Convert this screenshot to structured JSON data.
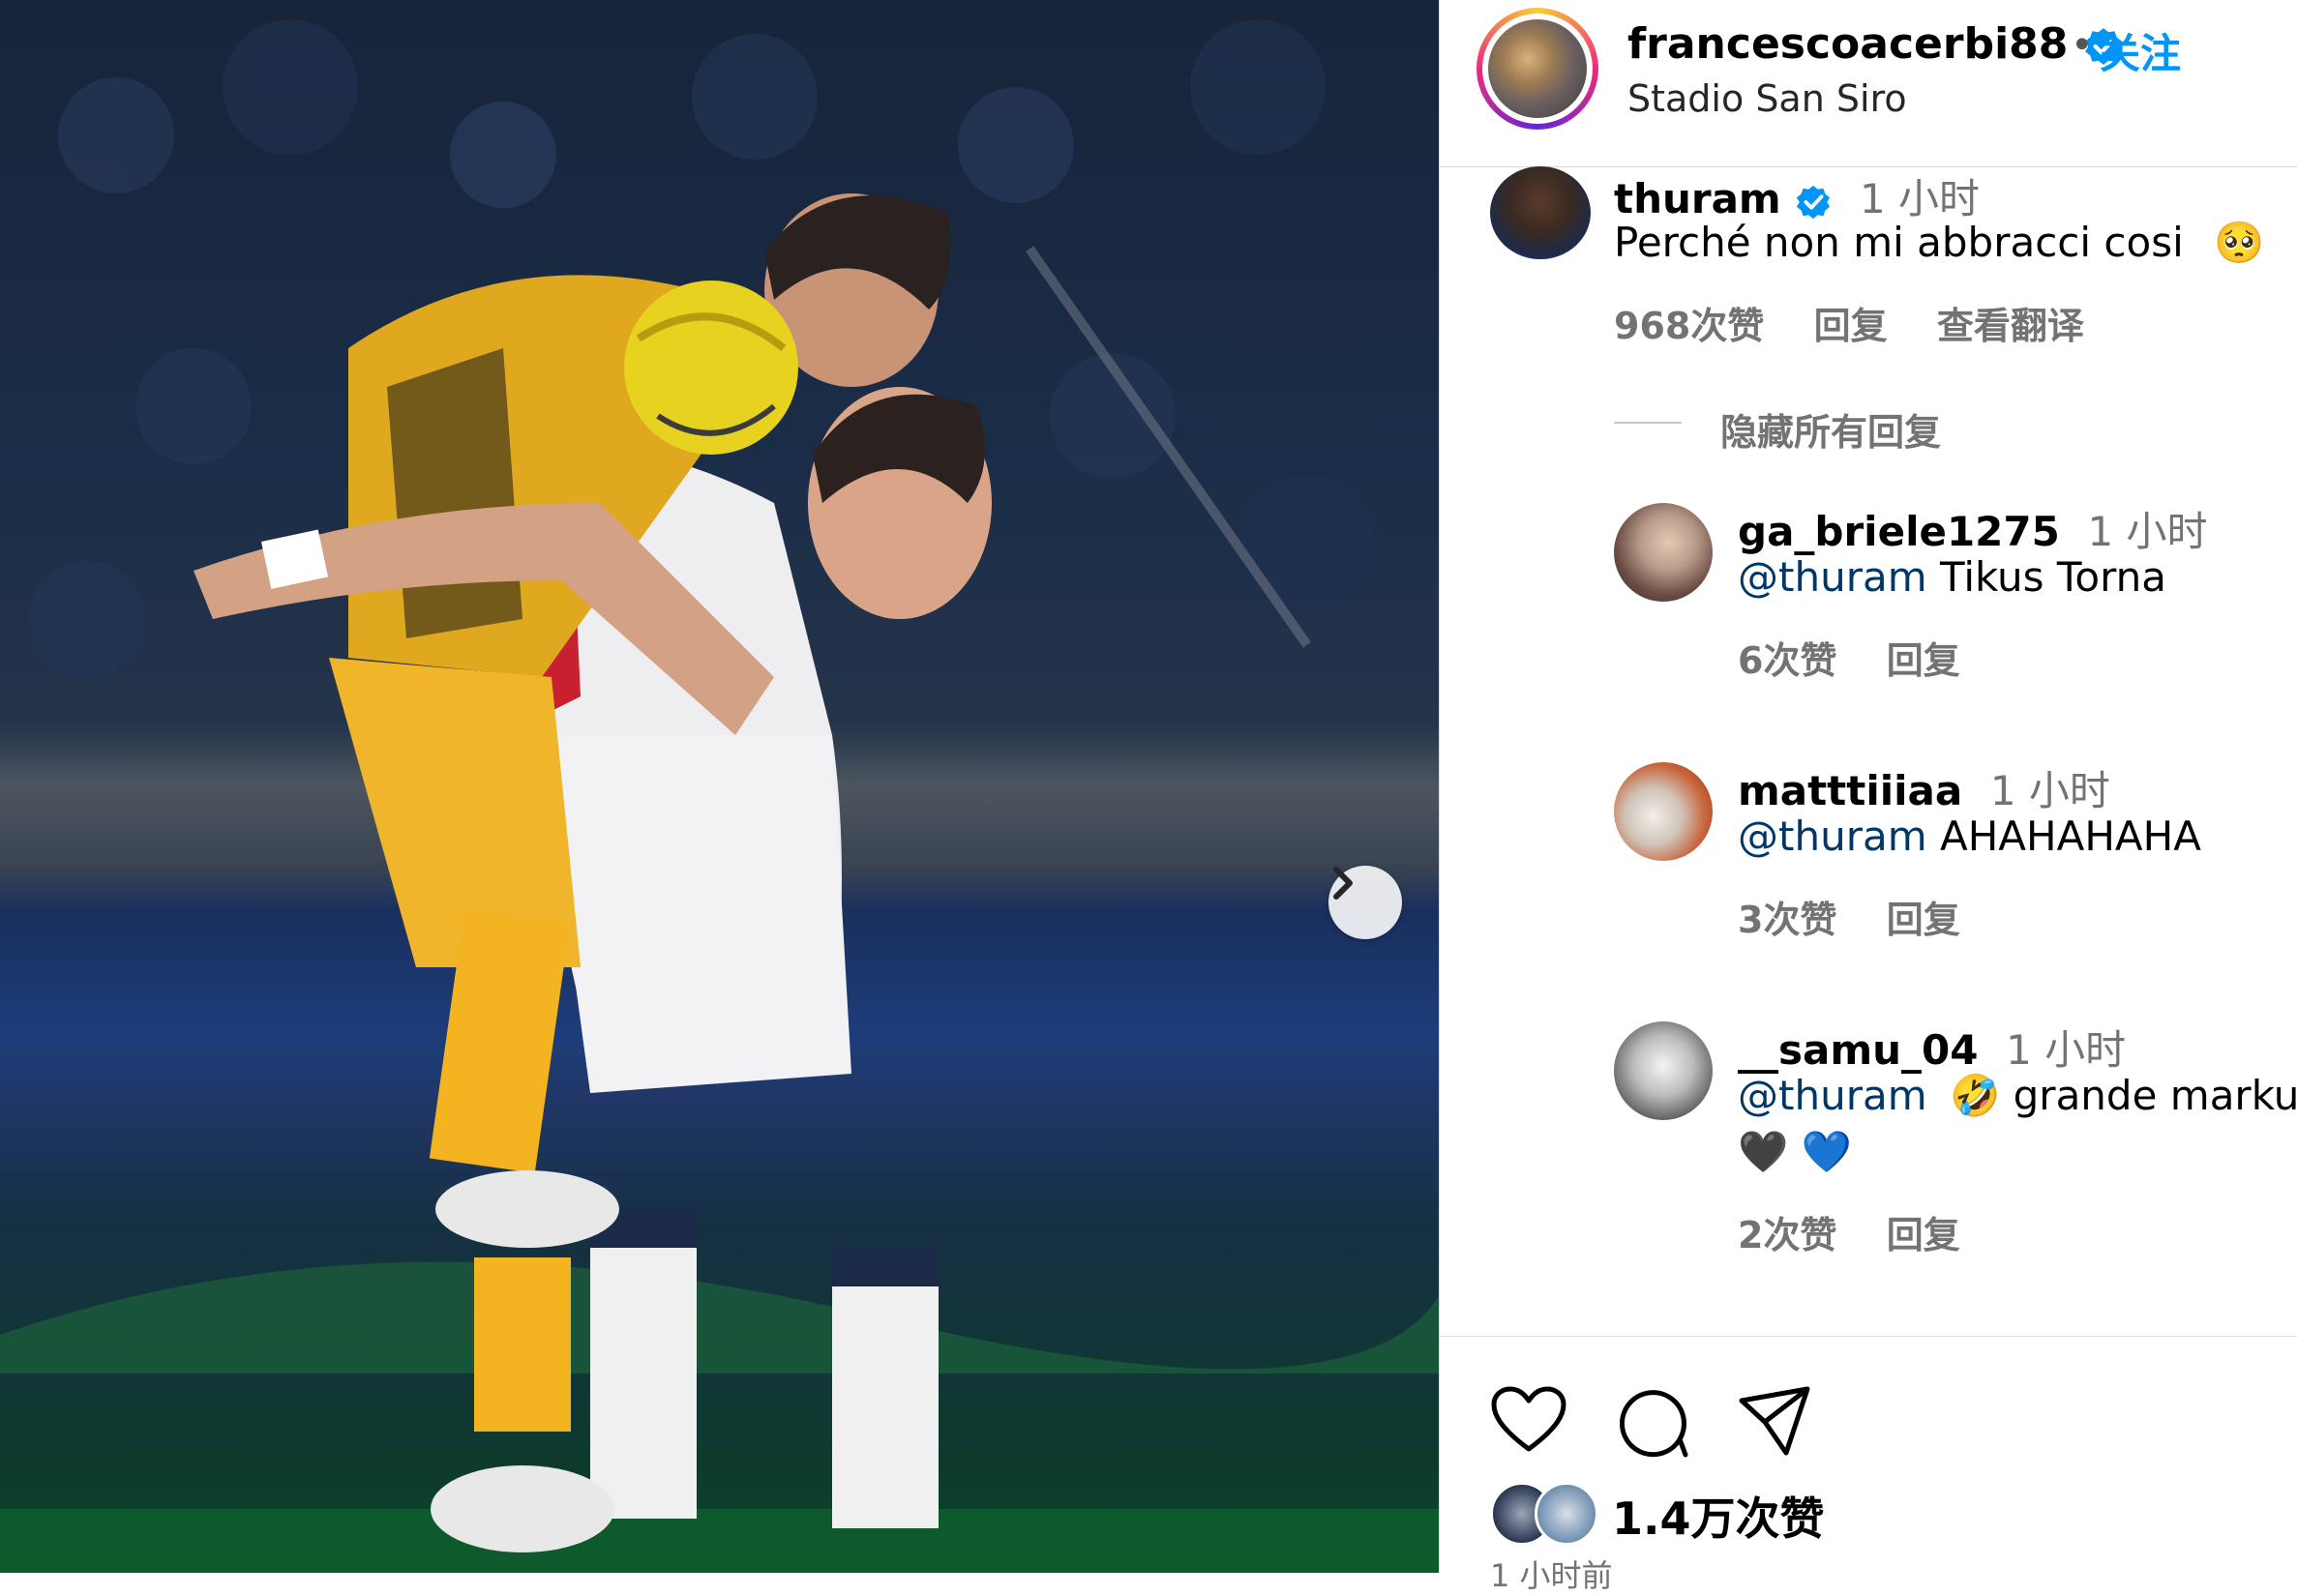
{
  "post": {
    "author": "francescoacerbi88",
    "dot": "•",
    "follow_label": "关注",
    "location": "Stadio San Siro"
  },
  "comments": [
    {
      "user": "thuram",
      "verified": true,
      "time": "1 小时",
      "text": "Perché non mi abbracci cosi",
      "emoji": "🥺",
      "likes": "968次赞",
      "reply": "回复",
      "translate": "查看翻译"
    }
  ],
  "hide_replies": "隐藏所有回复",
  "replies": [
    {
      "user": "ga_briele1275",
      "time": "1 小时",
      "mention": "@thuram",
      "text": "Tikus Torna",
      "likes": "6次赞",
      "reply": "回复"
    },
    {
      "user": "matttiiiaa",
      "time": "1 小时",
      "mention": "@thuram",
      "text": "AHAHAHAHA",
      "likes": "3次赞",
      "reply": "回复"
    },
    {
      "user": "__samu_04",
      "time": "1 小时",
      "mention": "@thuram",
      "emoji": "🤣",
      "text": "grande markus",
      "line2": "🖤 💙",
      "likes": "2次赞",
      "reply": "回复"
    }
  ],
  "footer": {
    "likes": "1.4万次赞",
    "time": "1 小时前"
  },
  "icons": [
    "verified-badge-icon",
    "heart-icon",
    "comment-icon",
    "share-icon",
    "chevron-right-icon"
  ],
  "colors": {
    "accent": "#0095f6",
    "mention": "#00376b",
    "secondary": "#737373"
  }
}
